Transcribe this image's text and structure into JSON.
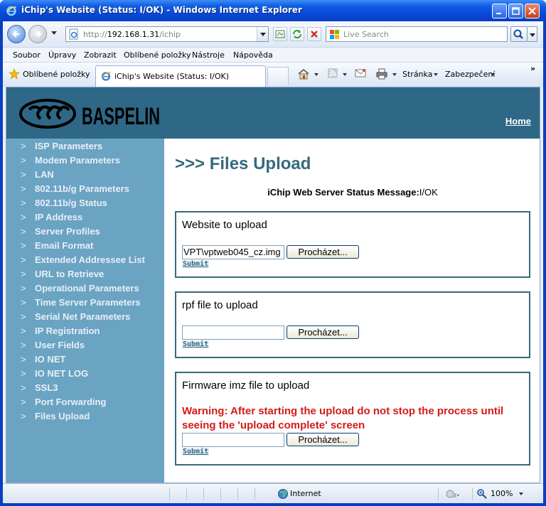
{
  "window": {
    "title": "iChip's Website (Status: I/OK) - Windows Internet Explorer"
  },
  "address": {
    "url_scheme": "http://",
    "url_host": "192.168.1.31",
    "url_path": "/ichip"
  },
  "search": {
    "placeholder": "Live Search"
  },
  "menu": [
    "Soubor",
    "Úpravy",
    "Zobrazit",
    "Oblíbené položky",
    "Nástroje",
    "Nápověda"
  ],
  "favorites": {
    "label": "Oblíbené položky",
    "tab_label": "iChip's Website (Status: I/OK)",
    "page_menu": "Stránka",
    "safety_menu": "Zabezpečení",
    "more": "»"
  },
  "page": {
    "logo_text": "BASPELIN",
    "home_link": "Home",
    "nav_marker": ">",
    "sidebar": [
      "ISP Parameters",
      "Modem Parameters",
      "LAN",
      "802.11b/g Parameters",
      "802.11b/g Status",
      "IP Address",
      "Server Profiles",
      "Email Format",
      "Extended Addressee List",
      "URL to Retrieve",
      "Operational Parameters",
      "Time Server Parameters",
      "Serial Net Parameters",
      "IP Registration",
      "User Fields",
      "IO NET",
      "IO NET LOG",
      "SSL3",
      "Port Forwarding",
      "Files Upload"
    ],
    "heading": ">>> Files Upload",
    "status_label": "iChip Web Server Status Message:",
    "status_value": "I/OK",
    "browse_label": "Procházet...",
    "submit_label": "Submit",
    "boxes": {
      "website": {
        "title": "Website to upload",
        "file_value": "VPT\\vptweb045_cz.img"
      },
      "rpf": {
        "title": "rpf file to upload",
        "file_value": ""
      },
      "firmware": {
        "title": "Firmware imz file to upload",
        "warning": "Warning: After starting the upload do not stop the process until seeing the 'upload complete' screen",
        "file_value": ""
      }
    }
  },
  "statusbar": {
    "zone": "Internet",
    "zoom": "100%"
  },
  "colors": {
    "header_bg": "#2e6886",
    "sidebar_bg": "#6ba3c3",
    "heading": "#356a7e",
    "warning": "#d41a1a"
  }
}
